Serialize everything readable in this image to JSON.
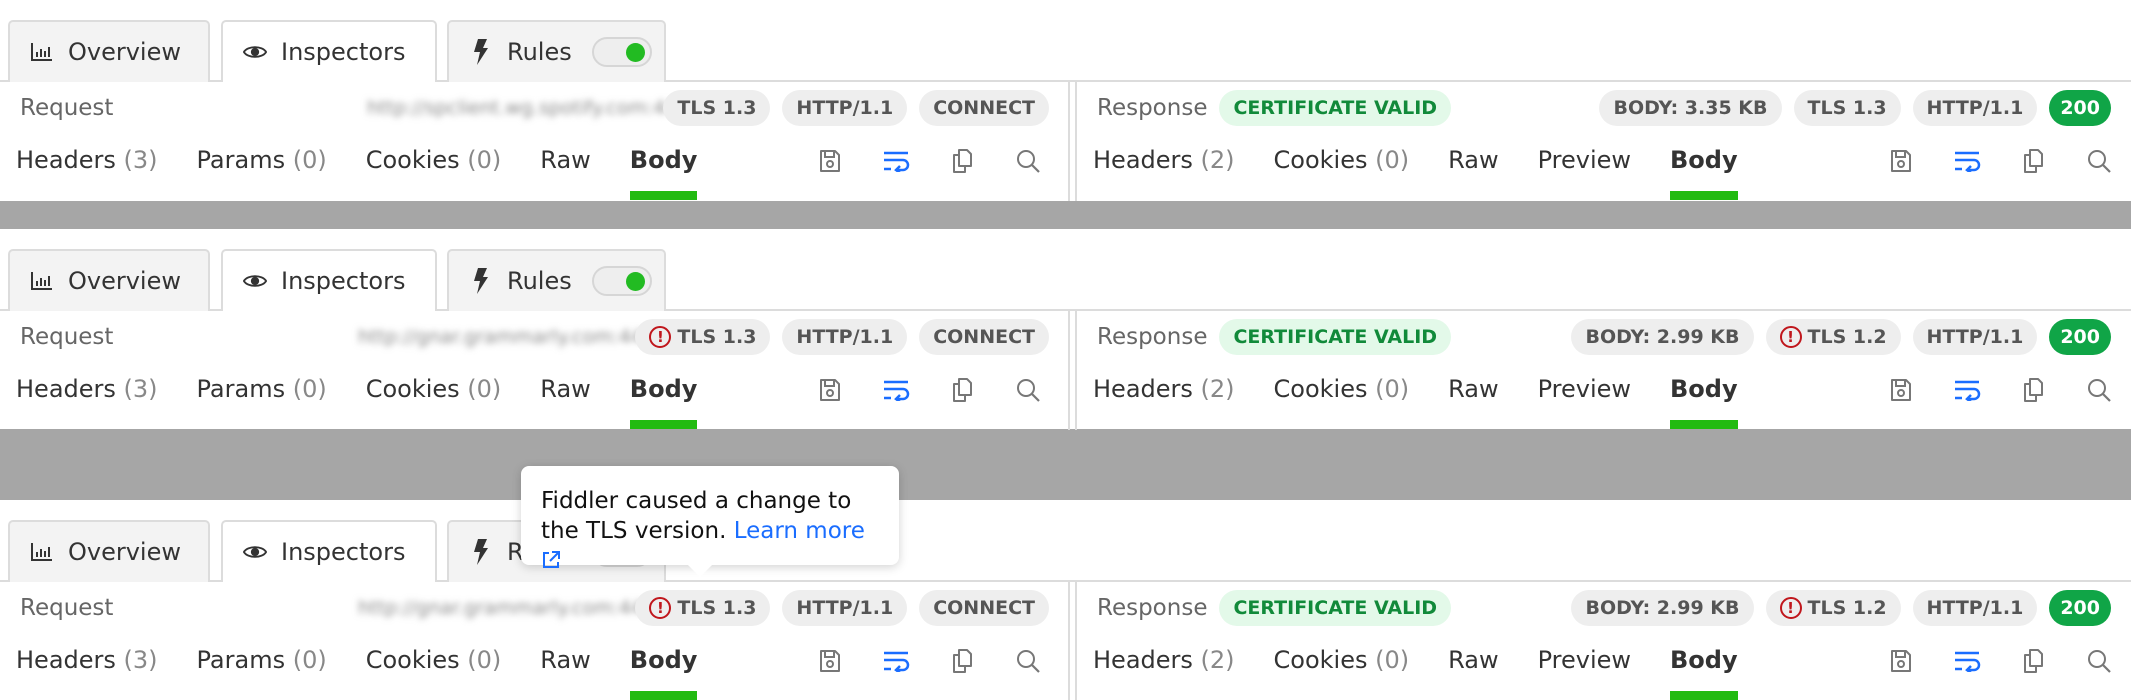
{
  "main_tabs": {
    "overview": "Overview",
    "inspectors": "Inspectors",
    "rules": "Rules",
    "rules_toggle_on": true
  },
  "colors": {
    "accent_green": "#22bb11",
    "status_green": "#10a547",
    "warning_red": "#c0161c",
    "link_blue": "#1a6dff",
    "separator_gray": "#a6a6a6"
  },
  "labels": {
    "request": "Request",
    "response": "Response"
  },
  "request_tabs": [
    {
      "label": "Headers",
      "count": "(3)"
    },
    {
      "label": "Params",
      "count": "(0)"
    },
    {
      "label": "Cookies",
      "count": "(0)"
    },
    {
      "label": "Raw",
      "count": ""
    },
    {
      "label": "Body",
      "count": ""
    }
  ],
  "response_tabs": [
    {
      "label": "Headers",
      "count": "(2)"
    },
    {
      "label": "Cookies",
      "count": "(0)"
    },
    {
      "label": "Raw",
      "count": ""
    },
    {
      "label": "Preview",
      "count": ""
    },
    {
      "label": "Body",
      "count": ""
    }
  ],
  "active_subtab": "Body",
  "toolbar_icons": [
    "save-icon",
    "word-wrap-icon",
    "copy-icon",
    "search-icon"
  ],
  "sessions": [
    {
      "request": {
        "url": "http://spclient.wg.spotify.com:443",
        "url_blurred": true,
        "tls": "TLS 1.3",
        "tls_warning": false,
        "http": "HTTP/1.1",
        "method": "CONNECT"
      },
      "response": {
        "certificate": "CERTIFICATE VALID",
        "body_size": "BODY: 3.35 KB",
        "tls": "TLS 1.3",
        "tls_warning": false,
        "http": "HTTP/1.1",
        "status": "200"
      }
    },
    {
      "request": {
        "url": "http://gnar.grammarly.com:443",
        "url_blurred": true,
        "tls": "TLS 1.3",
        "tls_warning": true,
        "http": "HTTP/1.1",
        "method": "CONNECT"
      },
      "response": {
        "certificate": "CERTIFICATE VALID",
        "body_size": "BODY: 2.99 KB",
        "tls": "TLS 1.2",
        "tls_warning": true,
        "http": "HTTP/1.1",
        "status": "200"
      }
    },
    {
      "request": {
        "url": "http://gnar.grammarly.com:443",
        "url_blurred": true,
        "tls": "TLS 1.3",
        "tls_warning": true,
        "http": "HTTP/1.1",
        "method": "CONNECT"
      },
      "response": {
        "certificate": "CERTIFICATE VALID",
        "body_size": "BODY: 2.99 KB",
        "tls": "TLS 1.2",
        "tls_warning": true,
        "http": "HTTP/1.1",
        "status": "200"
      }
    }
  ],
  "tooltip": {
    "text": "Fiddler caused a change to the TLS version.",
    "link": "Learn more"
  },
  "warn_glyph": "!"
}
